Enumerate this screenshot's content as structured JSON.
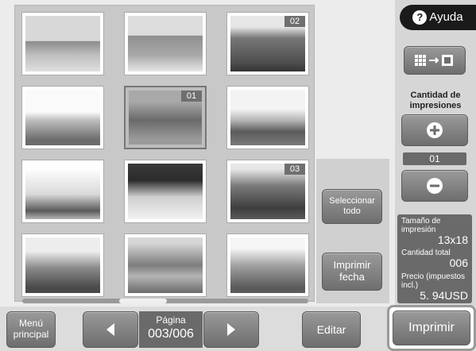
{
  "thumbnails": [
    {
      "badge": ""
    },
    {
      "badge": ""
    },
    {
      "badge": "02"
    },
    {
      "badge": ""
    },
    {
      "badge": "01"
    },
    {
      "badge": ""
    },
    {
      "badge": ""
    },
    {
      "badge": ""
    },
    {
      "badge": "03"
    },
    {
      "badge": ""
    },
    {
      "badge": ""
    },
    {
      "badge": ""
    }
  ],
  "buttons": {
    "help": "Ayuda",
    "select_all": "Seleccionar todo",
    "print_date": "Imprimir fecha",
    "main_menu": "Menú principal",
    "edit": "Editar",
    "print": "Imprimir"
  },
  "print_quantity": {
    "label": "Cantidad de impresiones",
    "value": "01"
  },
  "info": {
    "size_label": "Tamaño de impresión",
    "size_value": "13x18",
    "total_label": "Cantidad total",
    "total_value": "006",
    "price_label": "Precio (impuestos incl.)",
    "price_value": "5. 94USD"
  },
  "pagination": {
    "label": "Página",
    "value": "003/006"
  },
  "colors": {
    "dark": "#1a1a1a",
    "button_gray": "#6e6e6e",
    "panel": "#c8c8c8"
  }
}
